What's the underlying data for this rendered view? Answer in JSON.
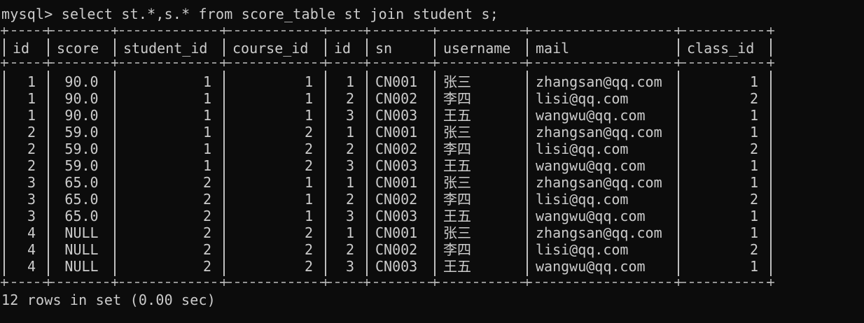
{
  "prompt": "mysql>",
  "command": "select st.*,s.* from score_table st join student s;",
  "footer": "12 rows in set (0.00 sec)",
  "table": {
    "columns": [
      "id",
      "score",
      "student_id",
      "course_id",
      "id",
      "sn",
      "username",
      "mail",
      "class_id"
    ],
    "rows": [
      [
        "1",
        "90.0",
        "1",
        "1",
        "1",
        "CN001",
        "张三",
        "zhangsan@qq.com",
        "1"
      ],
      [
        "1",
        "90.0",
        "1",
        "1",
        "2",
        "CN002",
        "李四",
        "lisi@qq.com",
        "2"
      ],
      [
        "1",
        "90.0",
        "1",
        "1",
        "3",
        "CN003",
        "王五",
        "wangwu@qq.com",
        "1"
      ],
      [
        "2",
        "59.0",
        "1",
        "2",
        "1",
        "CN001",
        "张三",
        "zhangsan@qq.com",
        "1"
      ],
      [
        "2",
        "59.0",
        "1",
        "2",
        "2",
        "CN002",
        "李四",
        "lisi@qq.com",
        "2"
      ],
      [
        "2",
        "59.0",
        "1",
        "2",
        "3",
        "CN003",
        "王五",
        "wangwu@qq.com",
        "1"
      ],
      [
        "3",
        "65.0",
        "2",
        "1",
        "1",
        "CN001",
        "张三",
        "zhangsan@qq.com",
        "1"
      ],
      [
        "3",
        "65.0",
        "2",
        "1",
        "2",
        "CN002",
        "李四",
        "lisi@qq.com",
        "2"
      ],
      [
        "3",
        "65.0",
        "2",
        "1",
        "3",
        "CN003",
        "王五",
        "wangwu@qq.com",
        "1"
      ],
      [
        "4",
        "NULL",
        "2",
        "2",
        "1",
        "CN001",
        "张三",
        "zhangsan@qq.com",
        "1"
      ],
      [
        "4",
        "NULL",
        "2",
        "2",
        "2",
        "CN002",
        "李四",
        "lisi@qq.com",
        "2"
      ],
      [
        "4",
        "NULL",
        "2",
        "2",
        "3",
        "CN003",
        "王五",
        "wangwu@qq.com",
        "1"
      ]
    ]
  },
  "colors": {
    "background": "#0c0c0c",
    "text": "#cccccc"
  }
}
